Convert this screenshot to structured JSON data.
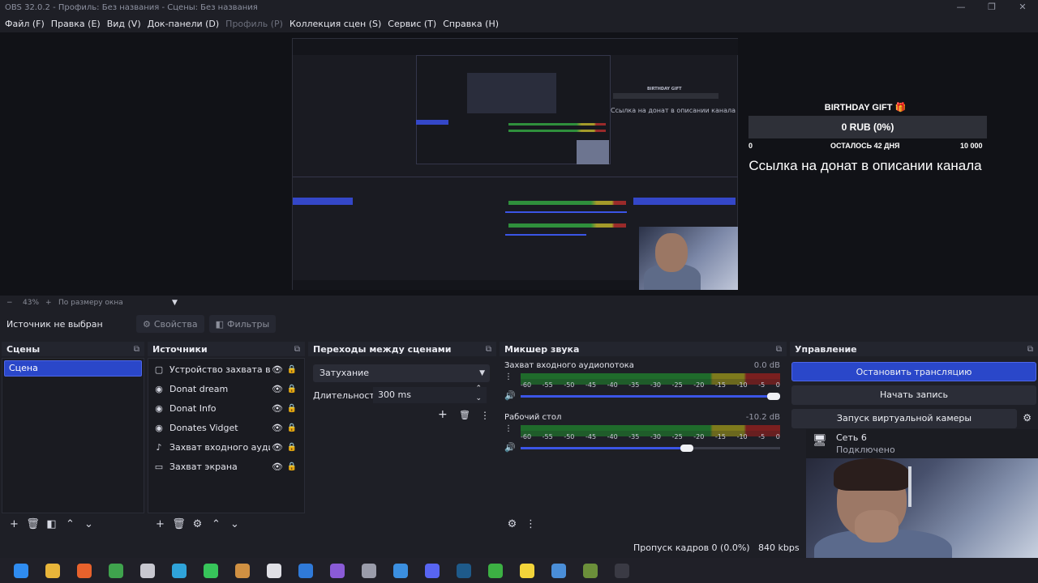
{
  "window": {
    "title": "OBS 32.0.2 - Профиль: Без названия - Сцены: Без названия",
    "minimize": "—",
    "maximize": "❐",
    "close": "✕"
  },
  "menu": [
    {
      "label": "Файл (F)",
      "enabled": true
    },
    {
      "label": "Правка (E)",
      "enabled": true
    },
    {
      "label": "Вид (V)",
      "enabled": true
    },
    {
      "label": "Док-панели (D)",
      "enabled": true
    },
    {
      "label": "Профиль (P)",
      "enabled": false
    },
    {
      "label": "Коллекция сцен (S)",
      "enabled": true
    },
    {
      "label": "Сервис (T)",
      "enabled": true
    },
    {
      "label": "Справка (H)",
      "enabled": true
    }
  ],
  "overlay": {
    "gift_title": "BIRTHDAY GIFT 🎁",
    "amount": "0 RUB (0%)",
    "min": "0",
    "remaining": "ОСТАЛОСЬ 42 ДНЯ",
    "max": "10 000",
    "link_text": "Ссылка на донат в описании канала",
    "progress_fraction": 0
  },
  "zoom": {
    "minus": "−",
    "value": "43%",
    "plus": "+",
    "mode": "По размеру окна",
    "arrow": "▼"
  },
  "source_bar": {
    "no_source": "Источник не выбран",
    "properties": "Свойства",
    "filters": "Фильтры"
  },
  "scenes": {
    "title": "Сцены",
    "items": [
      "Сцена"
    ],
    "selected": "Сцена"
  },
  "sources": {
    "title": "Источники",
    "items": [
      {
        "name": "Устройство захвата видео",
        "icon": "camera-icon",
        "glyph": "▢"
      },
      {
        "name": "Donat dream",
        "icon": "browser-icon",
        "glyph": "◉"
      },
      {
        "name": "Donat Info",
        "icon": "browser-icon",
        "glyph": "◉"
      },
      {
        "name": "Donates Vidget",
        "icon": "browser-icon",
        "glyph": "◉"
      },
      {
        "name": "Захват входного аудиопотока",
        "icon": "mic-icon",
        "glyph": "♪"
      },
      {
        "name": "Захват экрана",
        "icon": "monitor-icon",
        "glyph": "▭"
      }
    ]
  },
  "transitions": {
    "title": "Переходы между сценами",
    "selected": "Затухание",
    "duration_label": "Длительность",
    "duration_value": "300 ms"
  },
  "mixer": {
    "title": "Микшер звука",
    "scale": [
      "-60",
      "-55",
      "-50",
      "-45",
      "-40",
      "-35",
      "-30",
      "-25",
      "-20",
      "-15",
      "-10",
      "-5",
      "0"
    ],
    "channels": [
      {
        "name": "Захват входного аудиопотока",
        "db": "0.0 dB",
        "volume_fraction": 1.0
      },
      {
        "name": "Рабочий стол",
        "db": "-10.2 dB",
        "volume_fraction": 0.64
      }
    ]
  },
  "controls": {
    "title": "Управление",
    "stop_stream": "Остановить трансляцию",
    "start_record": "Начать запись",
    "virtual_cam": "Запуск виртуальной камеры"
  },
  "status": {
    "dropped_frames": "Пропуск кадров 0 (0.0%)",
    "bitrate": "840 kbps"
  },
  "notification": {
    "title": "Сеть 6",
    "subtitle": "Подключено"
  },
  "colors": {
    "accent": "#2a47c9",
    "background": "#1e1f26",
    "panel": "#1a1b21"
  },
  "taskbar": [
    {
      "name": "windows-start-icon",
      "color": "#2f8cf0"
    },
    {
      "name": "file-explorer-icon",
      "color": "#e8b53a"
    },
    {
      "name": "firefox-icon",
      "color": "#e8622c"
    },
    {
      "name": "chrome-icon",
      "color": "#3fa34d"
    },
    {
      "name": "app-cube-icon",
      "color": "#c8c8d0"
    },
    {
      "name": "telegram-icon",
      "color": "#2fa3d9"
    },
    {
      "name": "whatsapp-icon",
      "color": "#37c45a"
    },
    {
      "name": "folder-app-icon",
      "color": "#d09042"
    },
    {
      "name": "app-s-icon",
      "color": "#e0e0e6"
    },
    {
      "name": "vscode-icon",
      "color": "#2f7ad9"
    },
    {
      "name": "visual-studio-icon",
      "color": "#8a5bd6"
    },
    {
      "name": "usb-icon",
      "color": "#9a9caa"
    },
    {
      "name": "app-window-icon",
      "color": "#3b8fe0"
    },
    {
      "name": "discord-icon",
      "color": "#5865f2"
    },
    {
      "name": "steam-icon",
      "color": "#1e5a8a"
    },
    {
      "name": "xbox-icon",
      "color": "#3cb043"
    },
    {
      "name": "sticky-note-icon",
      "color": "#f2d43a"
    },
    {
      "name": "calculator-icon",
      "color": "#4a8ed8"
    },
    {
      "name": "minecraft-icon",
      "color": "#6b8f3a"
    },
    {
      "name": "obs-icon",
      "color": "#3a3a44"
    }
  ]
}
